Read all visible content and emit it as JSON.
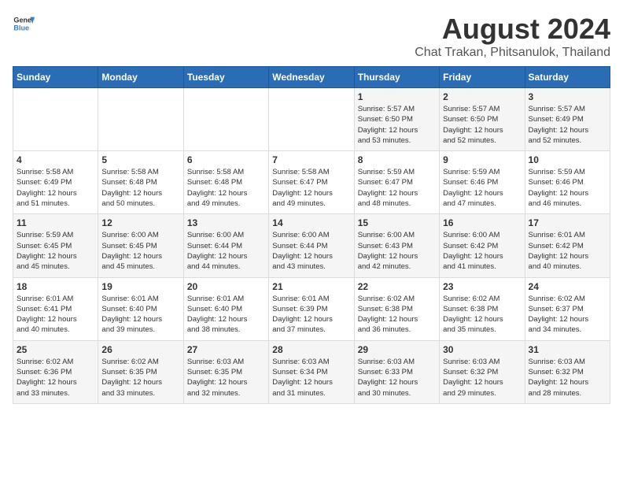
{
  "header": {
    "logo_general": "General",
    "logo_blue": "Blue",
    "title": "August 2024",
    "subtitle": "Chat Trakan, Phitsanulok, Thailand"
  },
  "days_of_week": [
    "Sunday",
    "Monday",
    "Tuesday",
    "Wednesday",
    "Thursday",
    "Friday",
    "Saturday"
  ],
  "weeks": [
    [
      {
        "day": "",
        "text": ""
      },
      {
        "day": "",
        "text": ""
      },
      {
        "day": "",
        "text": ""
      },
      {
        "day": "",
        "text": ""
      },
      {
        "day": "1",
        "text": "Sunrise: 5:57 AM\nSunset: 6:50 PM\nDaylight: 12 hours\nand 53 minutes."
      },
      {
        "day": "2",
        "text": "Sunrise: 5:57 AM\nSunset: 6:50 PM\nDaylight: 12 hours\nand 52 minutes."
      },
      {
        "day": "3",
        "text": "Sunrise: 5:57 AM\nSunset: 6:49 PM\nDaylight: 12 hours\nand 52 minutes."
      }
    ],
    [
      {
        "day": "4",
        "text": "Sunrise: 5:58 AM\nSunset: 6:49 PM\nDaylight: 12 hours\nand 51 minutes."
      },
      {
        "day": "5",
        "text": "Sunrise: 5:58 AM\nSunset: 6:48 PM\nDaylight: 12 hours\nand 50 minutes."
      },
      {
        "day": "6",
        "text": "Sunrise: 5:58 AM\nSunset: 6:48 PM\nDaylight: 12 hours\nand 49 minutes."
      },
      {
        "day": "7",
        "text": "Sunrise: 5:58 AM\nSunset: 6:47 PM\nDaylight: 12 hours\nand 49 minutes."
      },
      {
        "day": "8",
        "text": "Sunrise: 5:59 AM\nSunset: 6:47 PM\nDaylight: 12 hours\nand 48 minutes."
      },
      {
        "day": "9",
        "text": "Sunrise: 5:59 AM\nSunset: 6:46 PM\nDaylight: 12 hours\nand 47 minutes."
      },
      {
        "day": "10",
        "text": "Sunrise: 5:59 AM\nSunset: 6:46 PM\nDaylight: 12 hours\nand 46 minutes."
      }
    ],
    [
      {
        "day": "11",
        "text": "Sunrise: 5:59 AM\nSunset: 6:45 PM\nDaylight: 12 hours\nand 45 minutes."
      },
      {
        "day": "12",
        "text": "Sunrise: 6:00 AM\nSunset: 6:45 PM\nDaylight: 12 hours\nand 45 minutes."
      },
      {
        "day": "13",
        "text": "Sunrise: 6:00 AM\nSunset: 6:44 PM\nDaylight: 12 hours\nand 44 minutes."
      },
      {
        "day": "14",
        "text": "Sunrise: 6:00 AM\nSunset: 6:44 PM\nDaylight: 12 hours\nand 43 minutes."
      },
      {
        "day": "15",
        "text": "Sunrise: 6:00 AM\nSunset: 6:43 PM\nDaylight: 12 hours\nand 42 minutes."
      },
      {
        "day": "16",
        "text": "Sunrise: 6:00 AM\nSunset: 6:42 PM\nDaylight: 12 hours\nand 41 minutes."
      },
      {
        "day": "17",
        "text": "Sunrise: 6:01 AM\nSunset: 6:42 PM\nDaylight: 12 hours\nand 40 minutes."
      }
    ],
    [
      {
        "day": "18",
        "text": "Sunrise: 6:01 AM\nSunset: 6:41 PM\nDaylight: 12 hours\nand 40 minutes."
      },
      {
        "day": "19",
        "text": "Sunrise: 6:01 AM\nSunset: 6:40 PM\nDaylight: 12 hours\nand 39 minutes."
      },
      {
        "day": "20",
        "text": "Sunrise: 6:01 AM\nSunset: 6:40 PM\nDaylight: 12 hours\nand 38 minutes."
      },
      {
        "day": "21",
        "text": "Sunrise: 6:01 AM\nSunset: 6:39 PM\nDaylight: 12 hours\nand 37 minutes."
      },
      {
        "day": "22",
        "text": "Sunrise: 6:02 AM\nSunset: 6:38 PM\nDaylight: 12 hours\nand 36 minutes."
      },
      {
        "day": "23",
        "text": "Sunrise: 6:02 AM\nSunset: 6:38 PM\nDaylight: 12 hours\nand 35 minutes."
      },
      {
        "day": "24",
        "text": "Sunrise: 6:02 AM\nSunset: 6:37 PM\nDaylight: 12 hours\nand 34 minutes."
      }
    ],
    [
      {
        "day": "25",
        "text": "Sunrise: 6:02 AM\nSunset: 6:36 PM\nDaylight: 12 hours\nand 33 minutes."
      },
      {
        "day": "26",
        "text": "Sunrise: 6:02 AM\nSunset: 6:35 PM\nDaylight: 12 hours\nand 33 minutes."
      },
      {
        "day": "27",
        "text": "Sunrise: 6:03 AM\nSunset: 6:35 PM\nDaylight: 12 hours\nand 32 minutes."
      },
      {
        "day": "28",
        "text": "Sunrise: 6:03 AM\nSunset: 6:34 PM\nDaylight: 12 hours\nand 31 minutes."
      },
      {
        "day": "29",
        "text": "Sunrise: 6:03 AM\nSunset: 6:33 PM\nDaylight: 12 hours\nand 30 minutes."
      },
      {
        "day": "30",
        "text": "Sunrise: 6:03 AM\nSunset: 6:32 PM\nDaylight: 12 hours\nand 29 minutes."
      },
      {
        "day": "31",
        "text": "Sunrise: 6:03 AM\nSunset: 6:32 PM\nDaylight: 12 hours\nand 28 minutes."
      }
    ]
  ]
}
